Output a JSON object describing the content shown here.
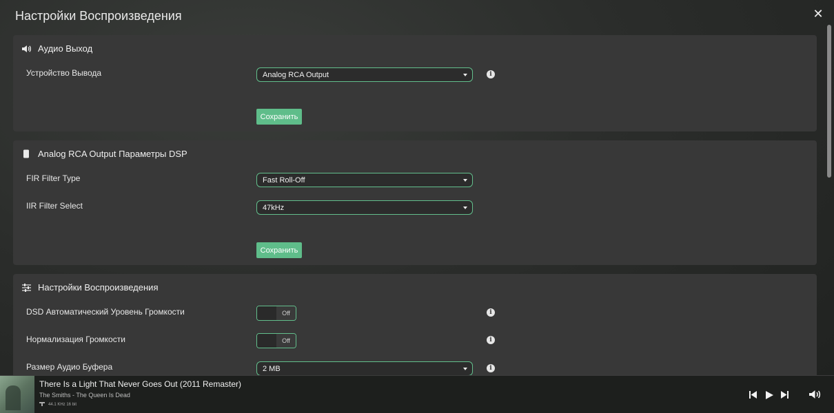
{
  "header": {
    "title": "Настройки Воспроизведения",
    "close_icon": "close-icon"
  },
  "audio_output": {
    "title": "Аудио Выход",
    "icon": "speaker-icon",
    "device_label": "Устройство Вывода",
    "device_value": "Analog RCA Output",
    "save_label": "Сохранить"
  },
  "dsp": {
    "title": "Analog RCA Output Параметры DSP",
    "icon": "device-icon",
    "fir_label": "FIR Filter Type",
    "fir_value": "Fast Roll-Off",
    "iir_label": "IIR Filter Select",
    "iir_value": "47kHz",
    "save_label": "Сохранить"
  },
  "playback": {
    "title": "Настройки Воспроизведения",
    "icon": "sliders-icon",
    "dsd_label": "DSD Автоматический Уровень Громкости",
    "dsd_state": "Off",
    "normalize_label": "Нормализация Громкости",
    "normalize_state": "Off",
    "buffer_label": "Размер Аудио Буфера",
    "buffer_value": "2 MB"
  },
  "player": {
    "title": "There Is a Light That Never Goes Out (2011 Remaster)",
    "subtitle": "The Smiths - The Queen Is Dead",
    "quality": "44.1 KHz 16 bit"
  },
  "colors": {
    "accent": "#5fbd8a",
    "panel": "#383838",
    "background": "#2b2d2b"
  }
}
